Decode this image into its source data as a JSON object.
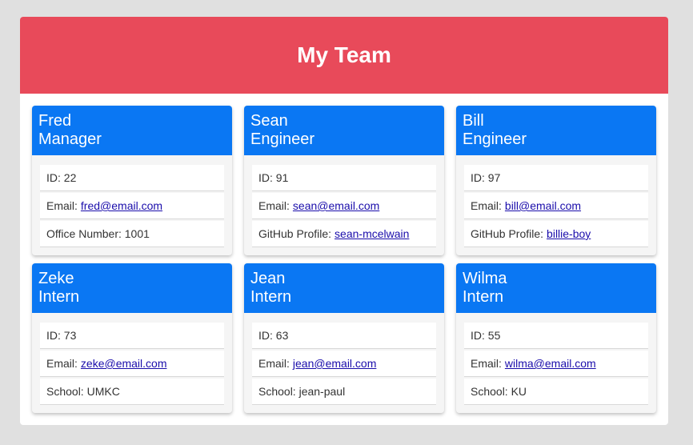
{
  "header": {
    "title": "My Team"
  },
  "team": [
    {
      "name": "Fred",
      "role": "Manager",
      "id_label": "ID: 22",
      "email_label": "Email:",
      "email": "fred@email.com",
      "extra_label": "Office Number: 1001",
      "extra_link": ""
    },
    {
      "name": "Sean",
      "role": "Engineer",
      "id_label": "ID: 91",
      "email_label": "Email:",
      "email": "sean@email.com",
      "extra_label": "GitHub Profile:",
      "extra_link": "sean-mcelwain"
    },
    {
      "name": "Bill",
      "role": "Engineer",
      "id_label": "ID: 97",
      "email_label": "Email:",
      "email": "bill@email.com",
      "extra_label": "GitHub Profile:",
      "extra_link": "billie-boy"
    },
    {
      "name": "Zeke",
      "role": "Intern",
      "id_label": "ID: 73",
      "email_label": "Email:",
      "email": "zeke@email.com",
      "extra_label": "School: UMKC",
      "extra_link": ""
    },
    {
      "name": "Jean",
      "role": "Intern",
      "id_label": "ID: 63",
      "email_label": "Email:",
      "email": "jean@email.com",
      "extra_label": "School: jean-paul",
      "extra_link": ""
    },
    {
      "name": "Wilma",
      "role": "Intern",
      "id_label": "ID: 55",
      "email_label": "Email:",
      "email": "wilma@email.com",
      "extra_label": "School: KU",
      "extra_link": ""
    }
  ],
  "colors": {
    "banner": "#e84a5a",
    "card_header": "#0a77f3",
    "link": "#1a0dab",
    "page_bg": "#e0e0e0"
  }
}
